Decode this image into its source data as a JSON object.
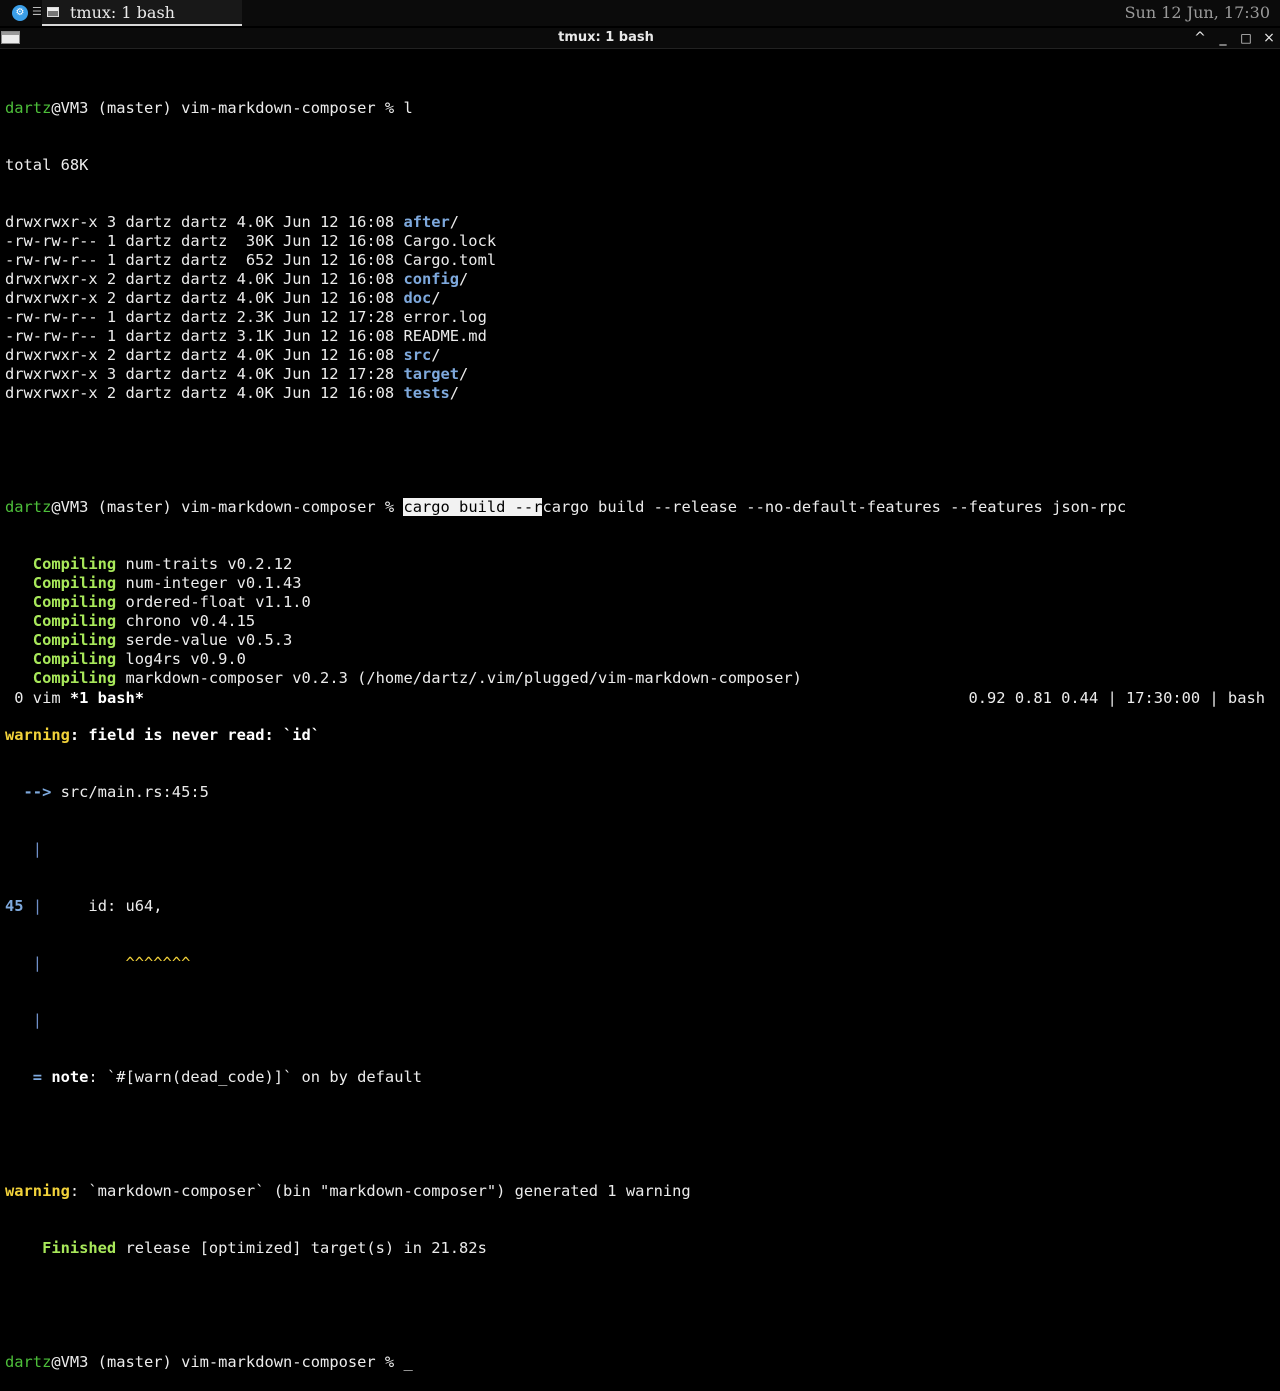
{
  "taskbar": {
    "app_icon": "gear-icon",
    "task_title": "tmux: 1 bash",
    "clock": "Sun 12 Jun, 17:30"
  },
  "window": {
    "title": "tmux: 1 bash",
    "controls": {
      "shade": "^",
      "minimize": "_",
      "maximize": "□",
      "close": "×"
    }
  },
  "terminal": {
    "prompt_user": "dartz",
    "prompt_rest": "@VM3 (master) vim-markdown-composer % ",
    "cmd1": "l",
    "total": "total 68K",
    "listing": [
      {
        "meta": "drwxrwxr-x 3 dartz dartz 4.0K Jun 12 16:08 ",
        "name": "after",
        "dir": true
      },
      {
        "meta": "-rw-rw-r-- 1 dartz dartz  30K Jun 12 16:08 ",
        "name": "Cargo.lock",
        "dir": false
      },
      {
        "meta": "-rw-rw-r-- 1 dartz dartz  652 Jun 12 16:08 ",
        "name": "Cargo.toml",
        "dir": false
      },
      {
        "meta": "drwxrwxr-x 2 dartz dartz 4.0K Jun 12 16:08 ",
        "name": "config",
        "dir": true
      },
      {
        "meta": "drwxrwxr-x 2 dartz dartz 4.0K Jun 12 16:08 ",
        "name": "doc",
        "dir": true
      },
      {
        "meta": "-rw-rw-r-- 1 dartz dartz 2.3K Jun 12 17:28 ",
        "name": "error.log",
        "dir": false
      },
      {
        "meta": "-rw-rw-r-- 1 dartz dartz 3.1K Jun 12 16:08 ",
        "name": "README.md",
        "dir": false
      },
      {
        "meta": "drwxrwxr-x 2 dartz dartz 4.0K Jun 12 16:08 ",
        "name": "src",
        "dir": true
      },
      {
        "meta": "drwxrwxr-x 3 dartz dartz 4.0K Jun 12 17:28 ",
        "name": "target",
        "dir": true
      },
      {
        "meta": "drwxrwxr-x 2 dartz dartz 4.0K Jun 12 16:08 ",
        "name": "tests",
        "dir": true
      }
    ],
    "cmd2_selected": "cargo build --r",
    "cmd2_rest": "cargo build --release --no-default-features --features json-rpc",
    "compiling_label": "   Compiling",
    "compiling": [
      " num-traits v0.2.12",
      " num-integer v0.1.43",
      " ordered-float v1.1.0",
      " chrono v0.4.15",
      " serde-value v0.5.3",
      " log4rs v0.9.0",
      " markdown-composer v0.2.3 (/home/dartz/.vim/plugged/vim-markdown-composer)"
    ],
    "warn_label": "warning",
    "warn1_msg": ": field is never read: `id`",
    "arrow": "  -->",
    "location": " src/main.rs:45:5",
    "gutter": "   |",
    "line_no": "45",
    "line_sep": " |",
    "code": "     id: u64,",
    "carets_pad": "         ",
    "carets": "^^^^^^^",
    "note_eq": "   =",
    "note_label": " note",
    "note_msg": ": `#[warn(dead_code)]` on by default",
    "warn2_msg": ": `markdown-composer` (bin \"markdown-composer\") generated 1 warning",
    "finished_label": "    Finished",
    "finished_msg": " release [optimized] target(s) in 21.82s",
    "final_cursor": "_"
  },
  "statusbar": {
    "left_inactive": " 0 vim ",
    "left_active": "*1 bash*",
    "right": "0.92 0.81 0.44 | 17:30:00 | bash"
  },
  "colors": {
    "background": "#000000",
    "foreground": "#ececec",
    "prompt_user": "#4dbf3a",
    "directory": "#7ea9dd",
    "compiling": "#a8e85a",
    "warning": "#f2d23a"
  }
}
